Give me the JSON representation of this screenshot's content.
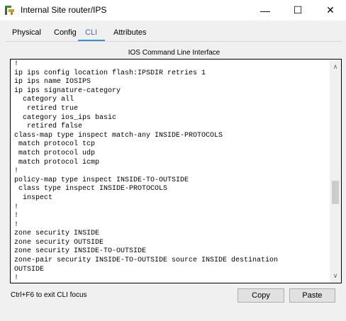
{
  "window": {
    "title": "Internal Site router/IPS",
    "minimize_glyph": "—",
    "maximize_glyph": "☐",
    "close_glyph": "✕"
  },
  "tabs": [
    {
      "label": "Physical",
      "selected": false
    },
    {
      "label": "Config",
      "selected": false
    },
    {
      "label": "CLI",
      "selected": true
    },
    {
      "label": "Attributes",
      "selected": false
    }
  ],
  "cli": {
    "section_title": "IOS Command Line Interface",
    "lines": [
      "!",
      "ip ips config location flash:IPSDIR retries 1",
      "ip ips name IOSIPS",
      "ip ips signature-category",
      "  category all",
      "   retired true",
      "  category ios_ips basic",
      "   retired false",
      "class-map type inspect match-any INSIDE-PROTOCOLS",
      " match protocol tcp",
      " match protocol udp",
      " match protocol icmp",
      "!",
      "policy-map type inspect INSIDE-TO-OUTSIDE",
      " class type inspect INSIDE-PROTOCOLS",
      "  inspect",
      "!",
      "!",
      "!",
      "zone security INSIDE",
      "zone security OUTSIDE",
      "zone security INSIDE-TO-OUTSIDE",
      "zone-pair security INSIDE-TO-OUTSIDE source INSIDE destination",
      "OUTSIDE",
      "!"
    ],
    "scroll_up_glyph": "∧",
    "scroll_down_glyph": "∨",
    "exit_hint": "Ctrl+F6 to exit CLI focus",
    "copy_label": "Copy",
    "paste_label": "Paste"
  },
  "colors": {
    "active_tab_underline": "#3d8fd6",
    "active_tab_text": "#3a6fb0"
  },
  "icons": {
    "app": "packet-tracer-router-icon"
  }
}
